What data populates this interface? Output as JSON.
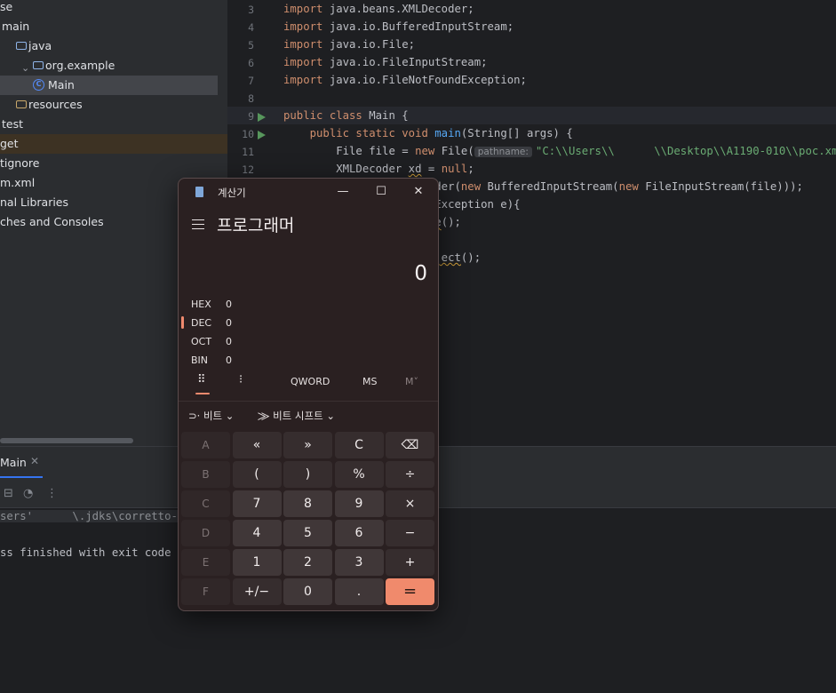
{
  "project_tree": [
    {
      "label": "se",
      "indent": 0,
      "icon": "none"
    },
    {
      "label": "main",
      "indent": 2,
      "icon": "none"
    },
    {
      "label": "java",
      "indent": 18,
      "icon": "folder"
    },
    {
      "label": "org.example",
      "indent": 37,
      "icon": "package"
    },
    {
      "label": "Main",
      "indent": 54,
      "icon": "class",
      "selected": true
    },
    {
      "label": "resources",
      "indent": 18,
      "icon": "resources"
    },
    {
      "label": "test",
      "indent": 2,
      "icon": "none"
    },
    {
      "label": "get",
      "indent": 0,
      "icon": "none",
      "highlighted": true
    },
    {
      "label": "tignore",
      "indent": 0,
      "icon": "none"
    },
    {
      "label": "m.xml",
      "indent": 0,
      "icon": "none"
    },
    {
      "label": "nal Libraries",
      "indent": 0,
      "icon": "none"
    },
    {
      "label": "ches and Consoles",
      "indent": 0,
      "icon": "none"
    }
  ],
  "editor": {
    "lines": [
      {
        "num": "3",
        "tokens": [
          {
            "t": "import ",
            "c": "kw"
          },
          {
            "t": "java.beans.XMLDecoder;"
          }
        ]
      },
      {
        "num": "4",
        "tokens": [
          {
            "t": "import ",
            "c": "kw"
          },
          {
            "t": "java.io.BufferedInputStream;"
          }
        ]
      },
      {
        "num": "5",
        "tokens": [
          {
            "t": "import ",
            "c": "kw"
          },
          {
            "t": "java.io.File;"
          }
        ]
      },
      {
        "num": "6",
        "tokens": [
          {
            "t": "import ",
            "c": "kw"
          },
          {
            "t": "java.io.FileInputStream;"
          }
        ]
      },
      {
        "num": "7",
        "tokens": [
          {
            "t": "import ",
            "c": "kw"
          },
          {
            "t": "java.io.FileNotFoundException;"
          }
        ]
      },
      {
        "num": "8",
        "tokens": []
      },
      {
        "num": "9",
        "run": true,
        "tokens": [
          {
            "t": "public class ",
            "c": "kw"
          },
          {
            "t": "Main {"
          }
        ]
      },
      {
        "num": "10",
        "run": true,
        "tokens": [
          {
            "t": "    public static void ",
            "c": "kw"
          },
          {
            "t": "main",
            "c": "fn"
          },
          {
            "t": "(String[] args) {"
          }
        ]
      },
      {
        "num": "11",
        "tokens": [
          {
            "t": "        File file = "
          },
          {
            "t": "new ",
            "c": "kw"
          },
          {
            "t": "File("
          },
          {
            "t": "pathname:",
            "c": "hint"
          },
          {
            "t": "\"C:\\\\Users\\\\",
            "c": "str"
          },
          {
            "t": "      "
          },
          {
            "t": "\\\\Desktop\\\\A1190-010\\\\poc.xml\"",
            "c": "str"
          },
          {
            "t": ");"
          }
        ]
      },
      {
        "num": "12",
        "tokens": [
          {
            "t": "        XMLDecoder "
          },
          {
            "t": "xd",
            "c": "squig"
          },
          {
            "t": " = "
          },
          {
            "t": "null",
            "c": "kw"
          },
          {
            "t": ";"
          }
        ]
      },
      {
        "num": "",
        "tokens": [
          {
            "t": "                  .Decoder("
          },
          {
            "t": "new ",
            "c": "kw"
          },
          {
            "t": "BufferedInputStream("
          },
          {
            "t": "new ",
            "c": "kw"
          },
          {
            "t": "FileInputStream(file)));"
          }
        ]
      },
      {
        "num": "",
        "tokens": [
          {
            "t": "                  FoundException e){"
          }
        ]
      },
      {
        "num": "",
        "tokens": [
          {
            "t": "                  "
          },
          {
            "t": "kTrace",
            "c": "squig"
          },
          {
            "t": "();"
          }
        ]
      },
      {
        "num": "",
        "tokens": []
      },
      {
        "num": "",
        "tokens": [
          {
            "t": "                  "
          },
          {
            "t": "eadObject",
            "c": "squig"
          },
          {
            "t": "();"
          }
        ]
      }
    ]
  },
  "run_panel": {
    "tab_label": "Main",
    "cmd_text": "sers'      \\.jdks\\corretto-1.8",
    "finished_text": "ss finished with exit code 0"
  },
  "calculator": {
    "window_title": "계산기",
    "mode": "프로그래머",
    "display_value": "0",
    "radix": [
      {
        "name": "HEX",
        "value": "0"
      },
      {
        "name": "DEC",
        "value": "0"
      },
      {
        "name": "OCT",
        "value": "0"
      },
      {
        "name": "BIN",
        "value": "0"
      }
    ],
    "active_radix": "DEC",
    "word_size": "QWORD",
    "memory_store": "MS",
    "memory_menu": "M˅",
    "bitwise_label": "비트",
    "bitshift_label": "비트 시프트",
    "keys": [
      [
        "A",
        "«",
        "»",
        "C",
        "⌫"
      ],
      [
        "B",
        "(",
        ")",
        "%",
        "÷"
      ],
      [
        "C",
        "7",
        "8",
        "9",
        "×"
      ],
      [
        "D",
        "4",
        "5",
        "6",
        "−"
      ],
      [
        "E",
        "1",
        "2",
        "3",
        "+"
      ],
      [
        "F",
        "+/−",
        "0",
        ".",
        "="
      ]
    ],
    "accent_color": "#f08a6c"
  }
}
